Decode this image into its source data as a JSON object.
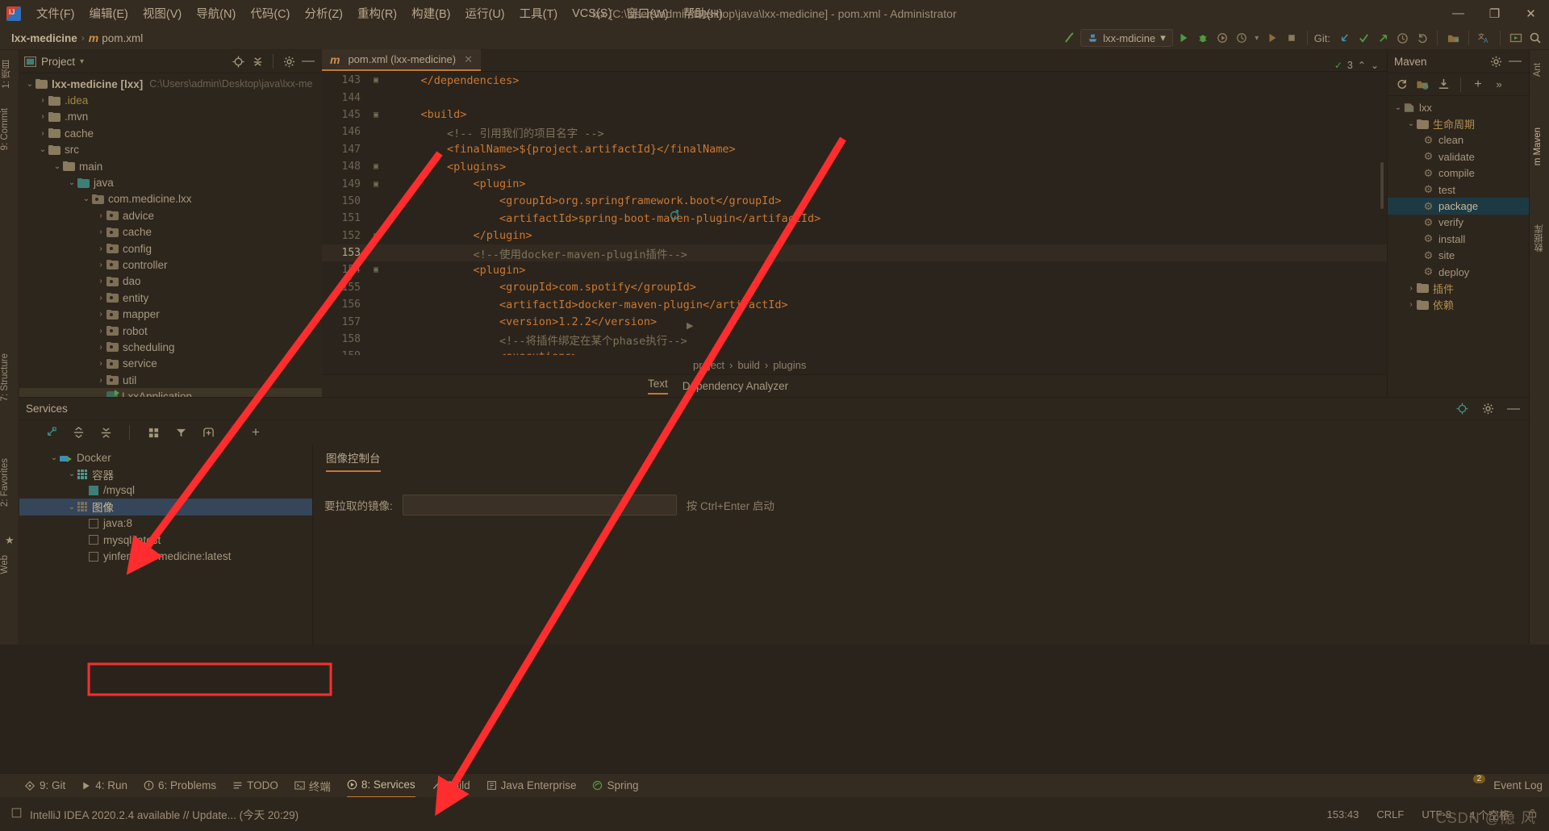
{
  "window": {
    "title": "lxx [C:\\Users\\admin\\Desktop\\java\\lxx-medicine] - pom.xml - Administrator",
    "minimize": "—",
    "maximize": "❐",
    "close": "✕"
  },
  "menu": {
    "items": [
      {
        "label": "文件(F)"
      },
      {
        "label": "编辑(E)"
      },
      {
        "label": "视图(V)"
      },
      {
        "label": "导航(N)"
      },
      {
        "label": "代码(C)"
      },
      {
        "label": "分析(Z)"
      },
      {
        "label": "重构(R)"
      },
      {
        "label": "构建(B)"
      },
      {
        "label": "运行(U)"
      },
      {
        "label": "工具(T)"
      },
      {
        "label": "VCS(S)"
      },
      {
        "label": "窗口(W)"
      },
      {
        "label": "帮助(H)"
      }
    ]
  },
  "navbar": {
    "breadcrumb_project": "lxx-medicine",
    "breadcrumb_sep": "›",
    "breadcrumb_file_badge": "m",
    "breadcrumb_file": "pom.xml",
    "run_config": "lxx-mdicine",
    "run_config_caret": "▾",
    "git_label": "Git:",
    "build_hammer": "build-icon",
    "run_icon": "▶",
    "debug_icon": "debug-icon",
    "coverage_icon": "coverage-icon",
    "profile_icon": "profile-icon",
    "stop_icon": "■"
  },
  "left_stripe": {
    "items": [
      "1: 项目",
      "9: Commit",
      "7: Structure",
      "2: Favorites",
      "Web"
    ]
  },
  "right_stripe": {
    "items": [
      "Ant",
      "m Maven",
      "数据库"
    ]
  },
  "project_panel": {
    "title": "Project",
    "caret": "▾",
    "tree": [
      {
        "depth": 0,
        "arrow": "v",
        "icon": "folder-module",
        "label": "lxx-medicine [lxx]",
        "bold": true,
        "path": "C:\\Users\\admin\\Desktop\\java\\lxx-me"
      },
      {
        "depth": 1,
        "arrow": ">",
        "icon": "folder",
        "label": ".idea",
        "color": "yellow"
      },
      {
        "depth": 1,
        "arrow": ">",
        "icon": "folder",
        "label": ".mvn"
      },
      {
        "depth": 1,
        "arrow": ">",
        "icon": "folder",
        "label": "cache"
      },
      {
        "depth": 1,
        "arrow": "v",
        "icon": "folder",
        "label": "src"
      },
      {
        "depth": 2,
        "arrow": "v",
        "icon": "folder",
        "label": "main"
      },
      {
        "depth": 3,
        "arrow": "v",
        "icon": "folder-src",
        "label": "java"
      },
      {
        "depth": 4,
        "arrow": "v",
        "icon": "folder-pkg",
        "label": "com.medicine.lxx"
      },
      {
        "depth": 5,
        "arrow": ">",
        "icon": "folder-pkg",
        "label": "advice"
      },
      {
        "depth": 5,
        "arrow": ">",
        "icon": "folder-pkg",
        "label": "cache"
      },
      {
        "depth": 5,
        "arrow": ">",
        "icon": "folder-pkg",
        "label": "config"
      },
      {
        "depth": 5,
        "arrow": ">",
        "icon": "folder-pkg",
        "label": "controller"
      },
      {
        "depth": 5,
        "arrow": ">",
        "icon": "folder-pkg",
        "label": "dao"
      },
      {
        "depth": 5,
        "arrow": ">",
        "icon": "folder-pkg",
        "label": "entity"
      },
      {
        "depth": 5,
        "arrow": ">",
        "icon": "folder-pkg",
        "label": "mapper"
      },
      {
        "depth": 5,
        "arrow": ">",
        "icon": "folder-pkg",
        "label": "robot"
      },
      {
        "depth": 5,
        "arrow": ">",
        "icon": "folder-pkg",
        "label": "scheduling"
      },
      {
        "depth": 5,
        "arrow": ">",
        "icon": "folder-pkg",
        "label": "service"
      },
      {
        "depth": 5,
        "arrow": ">",
        "icon": "folder-pkg",
        "label": "util"
      },
      {
        "depth": 5,
        "arrow": "",
        "icon": "class",
        "label": "LxxApplication",
        "selected": true
      }
    ]
  },
  "editor": {
    "tab": {
      "badge": "m",
      "label": "pom.xml (lxx-medicine)",
      "close": "✕"
    },
    "inspection_count": "3",
    "inspection_up": "⌃",
    "inspection_down": "⌄",
    "lines": [
      {
        "num": "143",
        "fold": "▣",
        "text": "    </dependencies>"
      },
      {
        "num": "144",
        "fold": "",
        "text": ""
      },
      {
        "num": "145",
        "fold": "▣",
        "text": "    <build>"
      },
      {
        "num": "146",
        "fold": "",
        "text": "        <!-- 引用我们的项目名字 -->"
      },
      {
        "num": "147",
        "fold": "",
        "text": "        <finalName>${project.artifactId}</finalName>"
      },
      {
        "num": "148",
        "fold": "▣",
        "text": "        <plugins>"
      },
      {
        "num": "149",
        "fold": "▣",
        "text": "            <plugin>"
      },
      {
        "num": "150",
        "fold": "",
        "text": "                <groupId>org.springframework.boot</groupId>"
      },
      {
        "num": "151",
        "fold": "",
        "text": "                <artifactId>spring-boot-maven-plugin</artifactId>"
      },
      {
        "num": "152",
        "fold": "▣",
        "text": "            </plugin>"
      },
      {
        "num": "153",
        "fold": "",
        "text": "            <!--使用docker-maven-plugin插件-->",
        "current": true
      },
      {
        "num": "154",
        "fold": "▣",
        "text": "            <plugin>"
      },
      {
        "num": "155",
        "fold": "",
        "text": "                <groupId>com.spotify</groupId>"
      },
      {
        "num": "156",
        "fold": "",
        "text": "                <artifactId>docker-maven-plugin</artifactId>"
      },
      {
        "num": "157",
        "fold": "",
        "text": "                <version>1.2.2</version>"
      },
      {
        "num": "158",
        "fold": "",
        "text": "                <!--将插件绑定在某个phase执行-->"
      },
      {
        "num": "159",
        "fold": "",
        "text": "                <executions>"
      }
    ],
    "breadcrumb": [
      "project",
      "build",
      "plugins"
    ],
    "breadcrumb_sep": "›",
    "bottom_tabs": [
      {
        "label": "Text",
        "active": true
      },
      {
        "label": "Dependency Analyzer",
        "active": false
      }
    ]
  },
  "maven_panel": {
    "title": "Maven",
    "toolbar_icons": [
      "refresh-icon",
      "add-folder-icon",
      "download-icon",
      "plus-icon",
      "more-icon"
    ],
    "tree": [
      {
        "depth": 0,
        "arrow": "v",
        "icon": "maven-module",
        "label": "lxx"
      },
      {
        "depth": 1,
        "arrow": "v",
        "icon": "lifecycle-folder",
        "label": "生命周期"
      },
      {
        "depth": 2,
        "arrow": "",
        "icon": "gear",
        "label": "clean"
      },
      {
        "depth": 2,
        "arrow": "",
        "icon": "gear",
        "label": "validate"
      },
      {
        "depth": 2,
        "arrow": "",
        "icon": "gear",
        "label": "compile"
      },
      {
        "depth": 2,
        "arrow": "",
        "icon": "gear",
        "label": "test"
      },
      {
        "depth": 2,
        "arrow": "",
        "icon": "gear",
        "label": "package",
        "selected": true
      },
      {
        "depth": 2,
        "arrow": "",
        "icon": "gear",
        "label": "verify"
      },
      {
        "depth": 2,
        "arrow": "",
        "icon": "gear",
        "label": "install"
      },
      {
        "depth": 2,
        "arrow": "",
        "icon": "gear",
        "label": "site"
      },
      {
        "depth": 2,
        "arrow": "",
        "icon": "gear",
        "label": "deploy"
      },
      {
        "depth": 1,
        "arrow": ">",
        "icon": "plugins-folder",
        "label": "插件"
      },
      {
        "depth": 1,
        "arrow": ">",
        "icon": "deps-folder",
        "label": "依赖"
      }
    ]
  },
  "services": {
    "title": "Services",
    "toolbar_icons": [
      "restore-layout-icon",
      "expand-all-icon",
      "collapse-all-icon",
      "group-icon",
      "filter-icon",
      "add-tab-icon",
      "plus-icon"
    ],
    "tree": [
      {
        "depth": 0,
        "arrow": "v",
        "icon": "docker",
        "label": "Docker"
      },
      {
        "depth": 1,
        "arrow": "v",
        "icon": "grid",
        "label": "容器"
      },
      {
        "depth": 2,
        "arrow": "",
        "icon": "box-filled",
        "label": "/mysql"
      },
      {
        "depth": 1,
        "arrow": "v",
        "icon": "grid-dim",
        "label": "图像",
        "selected": true
      },
      {
        "depth": 2,
        "arrow": "",
        "icon": "box",
        "label": "java:8"
      },
      {
        "depth": 2,
        "arrow": "",
        "icon": "box",
        "label": "mysql:latest"
      },
      {
        "depth": 2,
        "arrow": "",
        "icon": "box",
        "label": "yinfeng/lxx-medicine:latest",
        "highlighted": true
      }
    ],
    "detail_tab": "图像控制台",
    "pull_label": "要拉取的镜像:",
    "pull_value": "",
    "pull_hint": "按 Ctrl+Enter 启动"
  },
  "bottom_toolwindows": [
    {
      "label": "9: Git",
      "icon": "git-icon"
    },
    {
      "label": "4: Run",
      "icon": "run-icon"
    },
    {
      "label": "6: Problems",
      "icon": "problems-icon"
    },
    {
      "label": "TODO",
      "icon": "todo-icon"
    },
    {
      "label": "终端",
      "icon": "terminal-icon"
    },
    {
      "label": "8: Services",
      "icon": "services-icon",
      "active": true
    },
    {
      "label": "Build",
      "icon": "build-icon"
    },
    {
      "label": "Java Enterprise",
      "icon": "java-ee-icon"
    },
    {
      "label": "Spring",
      "icon": "spring-icon"
    }
  ],
  "event_log": {
    "label": "Event Log",
    "badge": "2"
  },
  "statusbar": {
    "message": "IntelliJ IDEA 2020.2.4 available // Update...  (今天 20:29)",
    "caret": "153:43",
    "line_sep": "CRLF",
    "encoding": "UTF-8",
    "indent": "4 个空格",
    "lock": "lock-icon"
  },
  "watermark": "CSDN @隐 风",
  "accent": {
    "orange": "#c07a32",
    "red_annotation": "#ff2d2d",
    "selection_blue": "#35455a",
    "maven_selection": "#1d3a44"
  }
}
